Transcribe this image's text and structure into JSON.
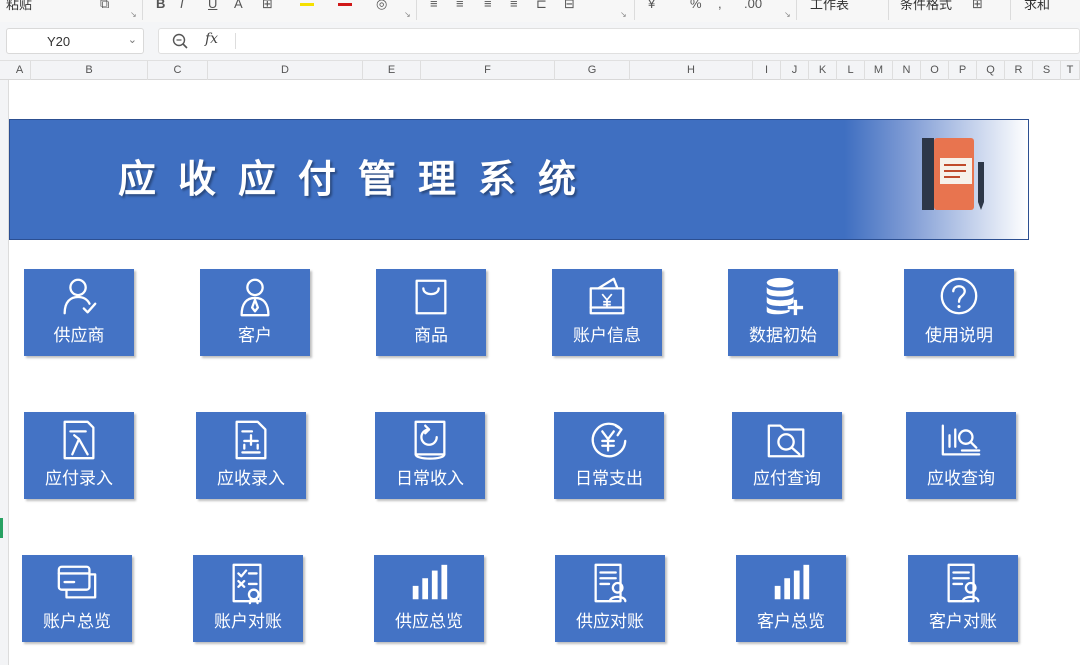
{
  "ribbon": {
    "item1": "粘贴",
    "item2": "工作表",
    "item3": "条件格式",
    "item4": "求和"
  },
  "formula_bar": {
    "cell_ref": "Y20",
    "formula": ""
  },
  "columns": [
    "A",
    "B",
    "C",
    "D",
    "E",
    "F",
    "G",
    "H",
    "I",
    "J",
    "K",
    "L",
    "M",
    "N",
    "O",
    "P",
    "Q",
    "R",
    "S",
    "T"
  ],
  "banner": {
    "title": "应收应付管理系统",
    "color": "#3f6fc1"
  },
  "tiles": [
    {
      "label": "供应商",
      "icon": "supplier-person-icon"
    },
    {
      "label": "客户",
      "icon": "customer-person-icon"
    },
    {
      "label": "商品",
      "icon": "shopping-bag-icon"
    },
    {
      "label": "账户信息",
      "icon": "wallet-yen-icon"
    },
    {
      "label": "数据初始",
      "icon": "database-plus-icon"
    },
    {
      "label": "使用说明",
      "icon": "help-circle-icon"
    },
    {
      "label": "应付录入",
      "icon": "document-in-icon"
    },
    {
      "label": "应收录入",
      "icon": "document-out-icon"
    },
    {
      "label": "日常收入",
      "icon": "book-refresh-icon"
    },
    {
      "label": "日常支出",
      "icon": "yen-circle-arrow-icon"
    },
    {
      "label": "应付查询",
      "icon": "folder-search-icon"
    },
    {
      "label": "应收查询",
      "icon": "chart-search-icon"
    },
    {
      "label": "账户总览",
      "icon": "cards-icon"
    },
    {
      "label": "账户对账",
      "icon": "checklist-icon"
    },
    {
      "label": "供应总览",
      "icon": "bar-chart-icon"
    },
    {
      "label": "供应对账",
      "icon": "report-person-icon"
    },
    {
      "label": "客户总览",
      "icon": "bar-chart-icon"
    },
    {
      "label": "客户对账",
      "icon": "report-person-icon"
    }
  ],
  "colors": {
    "tile": "#4473c5",
    "tile_text": "#ffffff"
  }
}
